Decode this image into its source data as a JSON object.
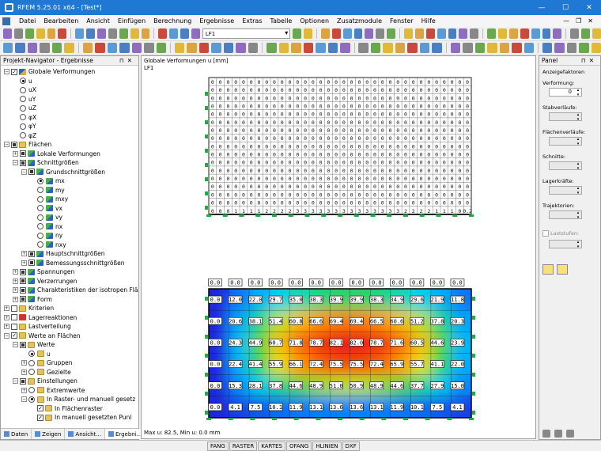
{
  "window": {
    "title": "RFEM 5.25.01 x64 - [Test*]",
    "controls": [
      "—",
      "☐",
      "✕"
    ]
  },
  "menu": {
    "items": [
      "Datei",
      "Bearbeiten",
      "Ansicht",
      "Einfügen",
      "Berechnung",
      "Ergebnisse",
      "Extras",
      "Tabelle",
      "Optionen",
      "Zusatzmodule",
      "Fenster",
      "Hilfe"
    ],
    "mdi_controls": [
      "—",
      "❐",
      "✕"
    ]
  },
  "toolbar": {
    "load_case": "LF1"
  },
  "navigator": {
    "title": "Projekt-Navigator - Ergebnisse",
    "items": [
      {
        "level": 0,
        "exp": "−",
        "ctl": "chk-on",
        "icon": "def",
        "label": "Globale Verformungen"
      },
      {
        "level": 1,
        "ctl": "rad-on",
        "label": "u"
      },
      {
        "level": 1,
        "ctl": "rad",
        "label": "uX"
      },
      {
        "level": 1,
        "ctl": "rad",
        "label": "uY"
      },
      {
        "level": 1,
        "ctl": "rad",
        "label": "uZ"
      },
      {
        "level": 1,
        "ctl": "rad",
        "label": "φX"
      },
      {
        "level": 1,
        "ctl": "rad",
        "label": "φY"
      },
      {
        "level": 1,
        "ctl": "rad",
        "label": "φZ"
      },
      {
        "level": 0,
        "exp": "−",
        "ctl": "chk-partial",
        "icon": "fold",
        "label": "Flächen"
      },
      {
        "level": 1,
        "exp": "+",
        "ctl": "chk-partial",
        "icon": "surf",
        "label": "Lokale Verformungen"
      },
      {
        "level": 1,
        "exp": "−",
        "ctl": "chk-partial",
        "icon": "surf",
        "label": "Schnittgrößen"
      },
      {
        "level": 2,
        "exp": "−",
        "ctl": "chk-partial",
        "icon": "surf",
        "label": "Grundschnittgrößen"
      },
      {
        "level": 3,
        "ctl": "rad-on",
        "icon": "surf",
        "label": "mx"
      },
      {
        "level": 3,
        "ctl": "rad",
        "icon": "surf",
        "label": "my"
      },
      {
        "level": 3,
        "ctl": "rad",
        "icon": "surf",
        "label": "mxy"
      },
      {
        "level": 3,
        "ctl": "rad",
        "icon": "surf",
        "label": "vx"
      },
      {
        "level": 3,
        "ctl": "rad",
        "icon": "surf",
        "label": "vy"
      },
      {
        "level": 3,
        "ctl": "rad",
        "icon": "surf",
        "label": "nx"
      },
      {
        "level": 3,
        "ctl": "rad",
        "icon": "surf",
        "label": "ny"
      },
      {
        "level": 3,
        "ctl": "rad",
        "icon": "surf",
        "label": "nxy"
      },
      {
        "level": 2,
        "exp": "+",
        "ctl": "chk-partial",
        "icon": "surf",
        "label": "Hauptschnittgrößen"
      },
      {
        "level": 2,
        "exp": "+",
        "ctl": "chk-partial",
        "icon": "surf",
        "label": "Bemessungsschnittgrößen"
      },
      {
        "level": 1,
        "exp": "+",
        "ctl": "chk-partial",
        "icon": "surf",
        "label": "Spannungen"
      },
      {
        "level": 1,
        "exp": "+",
        "ctl": "chk-partial",
        "icon": "surf",
        "label": "Verzerrungen"
      },
      {
        "level": 1,
        "exp": "+",
        "ctl": "chk-partial",
        "icon": "surf",
        "label": "Charakteristiken der isotropen Flä"
      },
      {
        "level": 1,
        "exp": "+",
        "ctl": "chk-partial",
        "icon": "surf",
        "label": "Form"
      },
      {
        "level": 0,
        "exp": "+",
        "ctl": "chk",
        "icon": "fold",
        "label": "Kriterien"
      },
      {
        "level": 0,
        "exp": "+",
        "ctl": "chk",
        "icon": "spring",
        "label": "Lagerreaktionen"
      },
      {
        "level": 0,
        "exp": "+",
        "ctl": "chk",
        "icon": "fold",
        "label": "Lastverteilung"
      },
      {
        "level": 0,
        "exp": "−",
        "ctl": "chk-on",
        "icon": "fold",
        "label": "Werte an Flächen"
      },
      {
        "level": 1,
        "exp": "−",
        "ctl": "chk-partial",
        "icon": "fold",
        "label": "Werte"
      },
      {
        "level": 2,
        "ctl": "rad-on",
        "icon": "fold",
        "label": "u"
      },
      {
        "level": 2,
        "exp": "+",
        "ctl": "rad",
        "icon": "fold",
        "label": "Gruppen"
      },
      {
        "level": 2,
        "exp": "+",
        "ctl": "rad",
        "icon": "fold",
        "label": "Gezielte"
      },
      {
        "level": 1,
        "exp": "−",
        "ctl": "chk-partial",
        "icon": "fold",
        "label": "Einstellungen"
      },
      {
        "level": 2,
        "exp": "+",
        "ctl": "rad",
        "icon": "fold",
        "label": "Extremwerte"
      },
      {
        "level": 2,
        "exp": "−",
        "ctl": "rad-on",
        "icon": "fold",
        "label": "In Raster- und manuell gesetz"
      },
      {
        "level": 3,
        "ctl": "chk-on",
        "icon": "fold",
        "label": "In Flächenraster"
      },
      {
        "level": 3,
        "ctl": "chk-on",
        "icon": "fold",
        "label": "In manuell gesetzten Punl"
      }
    ],
    "tabs": [
      "Daten",
      "Zeigen",
      "Ansicht...",
      "Ergebni..."
    ]
  },
  "view": {
    "title_line1": "Globale Verformungen u [mm]",
    "title_line2": "LF1",
    "status": "Max u: 82.5, Min u: 0.0 mm",
    "top_grid": {
      "rows": 17,
      "cols": 34,
      "bottom_row": [
        "0",
        "0",
        "0",
        "1",
        "1",
        "1",
        "1",
        "2",
        "2",
        "2",
        "2",
        "3",
        "3",
        "3",
        "3",
        "3",
        "3",
        "3",
        "3",
        "3",
        "3",
        "3",
        "3",
        "3",
        "3",
        "2",
        "2",
        "2",
        "2",
        "1",
        "1",
        "1",
        "0",
        "0.2"
      ]
    },
    "bottom_grid": {
      "header": [
        "0.0",
        "0.0",
        "0.0",
        "0.0",
        "0.0",
        "0.0",
        "0.0",
        "0.0",
        "0.0",
        "0.0",
        "0.0",
        "0.0",
        "0.0"
      ],
      "rows": [
        [
          "0.0",
          "12.0",
          "22.0",
          "29.7",
          "35.0",
          "38.3",
          "39.9",
          "39.9",
          "38.3",
          "34.9",
          "29.6",
          "21.9",
          "11.8"
        ],
        [
          "0.0",
          "20.6",
          "38.1",
          "51.4",
          "60.8",
          "66.6",
          "69.4",
          "69.4",
          "66.5",
          "60.6",
          "51.2",
          "37.8",
          "20.3"
        ],
        [
          "0.0",
          "24.3",
          "44.9",
          "60.7",
          "71.8",
          "78.7",
          "82.1",
          "82.0",
          "78.7",
          "71.6",
          "60.5",
          "44.6",
          "23.9"
        ],
        [
          "0.0",
          "22.4",
          "41.4",
          "55.9",
          "66.1",
          "72.4",
          "75.5",
          "75.5",
          "72.4",
          "65.9",
          "55.7",
          "41.1",
          "22.0"
        ],
        [
          "0.0",
          "15.3",
          "28.1",
          "37.8",
          "44.6",
          "48.9",
          "51.0",
          "50.9",
          "48.9",
          "44.6",
          "37.7",
          "27.9",
          "15.0"
        ],
        [
          "0.0",
          "4.1",
          "7.5",
          "10.1",
          "11.9",
          "13.1",
          "13.6",
          "13.6",
          "13.1",
          "11.9",
          "10.1",
          "7.5",
          "4.1"
        ]
      ]
    }
  },
  "panel": {
    "title": "Panel",
    "group": "Anzeigefaktoren",
    "labels": [
      "Verformung:",
      "Stabverläufe:",
      "Flächenverläufe:",
      "Schnitte:",
      "Lagerkräfte:",
      "Trajektorien:"
    ],
    "verformung_value": "0",
    "laststufen_label": "Laststufen:"
  },
  "statusbar": {
    "modes": [
      "FANG",
      "RASTER",
      "KARTES",
      "OFANG",
      "HLINIEN",
      "DXF"
    ]
  }
}
